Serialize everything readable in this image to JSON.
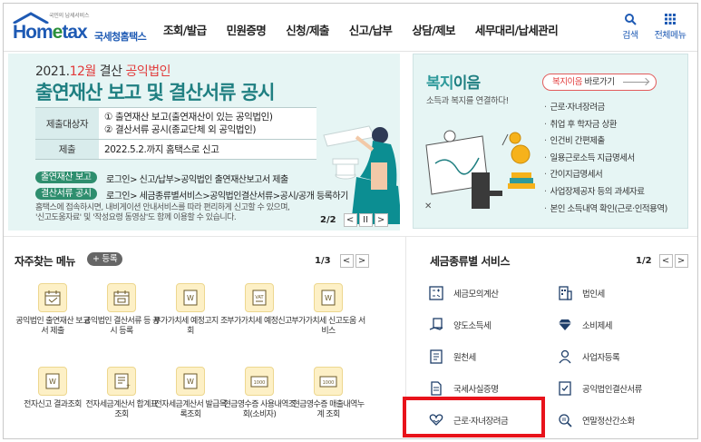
{
  "header": {
    "logo_tagline": "국민의 납세서비스",
    "logo_word_a": "Hom",
    "logo_word_b": "e",
    "logo_word_c": "tax",
    "logo_name": "국세청홈택스",
    "nav": [
      "조회/발급",
      "민원증명",
      "신청/제출",
      "신고/납부",
      "상담/제보",
      "세무대리/납세관리"
    ],
    "search_label": "검색",
    "allmenu_label": "전체메뉴"
  },
  "banner": {
    "line1_a": "2021.",
    "line1_b": "12월",
    "line1_c": " 결산 ",
    "line1_d": "공익법인",
    "line2": "출연재산 보고 및 결산서류 공시",
    "rows": [
      {
        "head": "제출대상자",
        "items": [
          "① 출연재산 보고(출연재산이 있는 공익법인)",
          "② 결산서류 공시(종교단체 외 공익법인)"
        ]
      },
      {
        "head": "제출",
        "items": [
          "2022.5.2.까지 홈택스로 신고"
        ]
      }
    ],
    "tag1": "출연재산 보고",
    "tag1_path": "로그인> 신고/납부>공익법인 출연재산보고서 제출",
    "tag2": "결산서류 공시",
    "tag2_path": "로그인> 세금종류별서비스>공익법인결산서류>공시/공개 등록하기",
    "note1": "홈택스에 접속하시면, 내비게이션 안내서비스를 따라 편리하게 신고할 수 있으며,",
    "note2": "'신고도움자료' 및 '작성요령 동영상'도 함께 이용할 수 있습니다.",
    "page": "2/2",
    "prev": "<",
    "pause": "II",
    "next": ">"
  },
  "welfare": {
    "title_a": "복지",
    "title_b": "이음",
    "subtitle": "소득과 복지를 연결하다!",
    "link_a": "복지이음",
    "link_b": " 바로가기",
    "items": [
      "근로·자녀장려금",
      "취업 후 학자금 상환",
      "인건비 간편제출",
      "일용근로소득 지급명세서",
      "간이지급명세서",
      "사업장제공자 등의 과세자료",
      "본인 소득내역 확인(근로·인적용역)"
    ]
  },
  "frequent": {
    "title": "자주찾는 메뉴",
    "add_label": "+ 등록",
    "page": "1/3",
    "prev": "<",
    "next": ">",
    "items": [
      {
        "label": "공익법인 출연재산 보고서 제출",
        "icon": "calendar-icon"
      },
      {
        "label": "공익법인 결산서류 등 공시 등록",
        "icon": "calendar-icon"
      },
      {
        "label": "부가가치세 예정고지 조회",
        "icon": "won-document-icon"
      },
      {
        "label": "부가가치세 예정신고",
        "icon": "vat-document-icon"
      },
      {
        "label": "부가가치세 신고도움 서비스",
        "icon": "won-document-icon"
      },
      {
        "label": "전자신고 결과조회",
        "icon": "won-document-icon"
      },
      {
        "label": "전자세금계산서 합계표조회",
        "icon": "invoice-icon"
      },
      {
        "label": "전자세금계산서 발급목록조회",
        "icon": "won-document-icon"
      },
      {
        "label": "현금영수증 사용내역조회(소비자)",
        "icon": "receipt-1000-icon"
      },
      {
        "label": "현금영수증 매출내역누계 조회",
        "icon": "receipt-1000-icon"
      }
    ]
  },
  "tax_service": {
    "title": "세금종류별 서비스",
    "page": "1/2",
    "prev": "<",
    "next": ">",
    "items": [
      {
        "label": "세금모의계산",
        "icon": "calculator-icon"
      },
      {
        "label": "법인세",
        "icon": "building-icon"
      },
      {
        "label": "양도소득세",
        "icon": "hand-document-icon"
      },
      {
        "label": "소비제세",
        "icon": "diamond-icon"
      },
      {
        "label": "원천세",
        "icon": "receipt-icon"
      },
      {
        "label": "사업자등록",
        "icon": "person-icon"
      },
      {
        "label": "국세사실증명",
        "icon": "document-icon"
      },
      {
        "label": "공익법인결산서류",
        "icon": "check-document-icon"
      },
      {
        "label": "근로·자녀장려금",
        "icon": "heart-hand-icon"
      },
      {
        "label": "연말정산간소화",
        "icon": "magnifier-icon"
      }
    ]
  },
  "colors": {
    "accent": "#1e5ab4",
    "teal": "#1f7f81",
    "red": "#e8131b",
    "banner_bg": "#e6f5f4"
  }
}
